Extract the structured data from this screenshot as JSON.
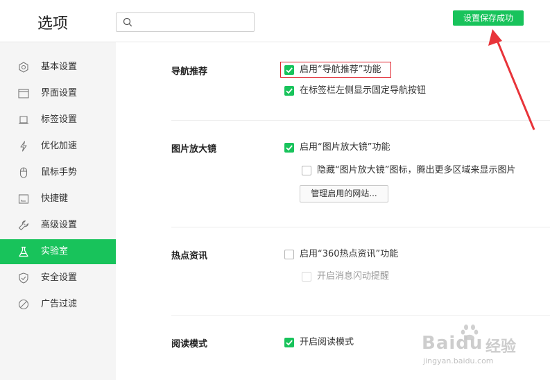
{
  "header": {
    "title": "选项",
    "search_placeholder": "",
    "toast": "设置保存成功"
  },
  "sidebar": {
    "items": [
      {
        "label": "基本设置",
        "icon": "gear-icon"
      },
      {
        "label": "界面设置",
        "icon": "window-icon"
      },
      {
        "label": "标签设置",
        "icon": "tab-icon"
      },
      {
        "label": "优化加速",
        "icon": "lightning-icon"
      },
      {
        "label": "鼠标手势",
        "icon": "mouse-icon"
      },
      {
        "label": "快捷键",
        "icon": "keyboard-icon"
      },
      {
        "label": "高级设置",
        "icon": "wrench-icon"
      },
      {
        "label": "实验室",
        "icon": "flask-icon"
      },
      {
        "label": "安全设置",
        "icon": "shield-icon"
      },
      {
        "label": "广告过滤",
        "icon": "block-icon"
      }
    ],
    "active_index": 7
  },
  "sections": {
    "nav": {
      "title": "导航推荐",
      "opt1": "启用“导航推荐”功能",
      "opt2": "在标签栏左侧显示固定导航按钮"
    },
    "magnifier": {
      "title": "图片放大镜",
      "opt1": "启用“图片放大镜”功能",
      "opt2": "隐藏“图片放大镜”图标，腾出更多区域来显示图片",
      "button": "管理启用的网站..."
    },
    "hotnews": {
      "title": "热点资讯",
      "opt1": "启用“360热点资讯”功能",
      "opt2": "开启消息闪动提醒"
    },
    "reading": {
      "title": "阅读模式",
      "opt1": "开启阅读模式"
    }
  },
  "watermark": {
    "brand": "Baidu",
    "brand_suffix": "经验",
    "url": "jingyan.baidu.com"
  },
  "colors": {
    "accent": "#18c35b",
    "highlight": "#e0202a",
    "arrow": "#e8343a"
  }
}
